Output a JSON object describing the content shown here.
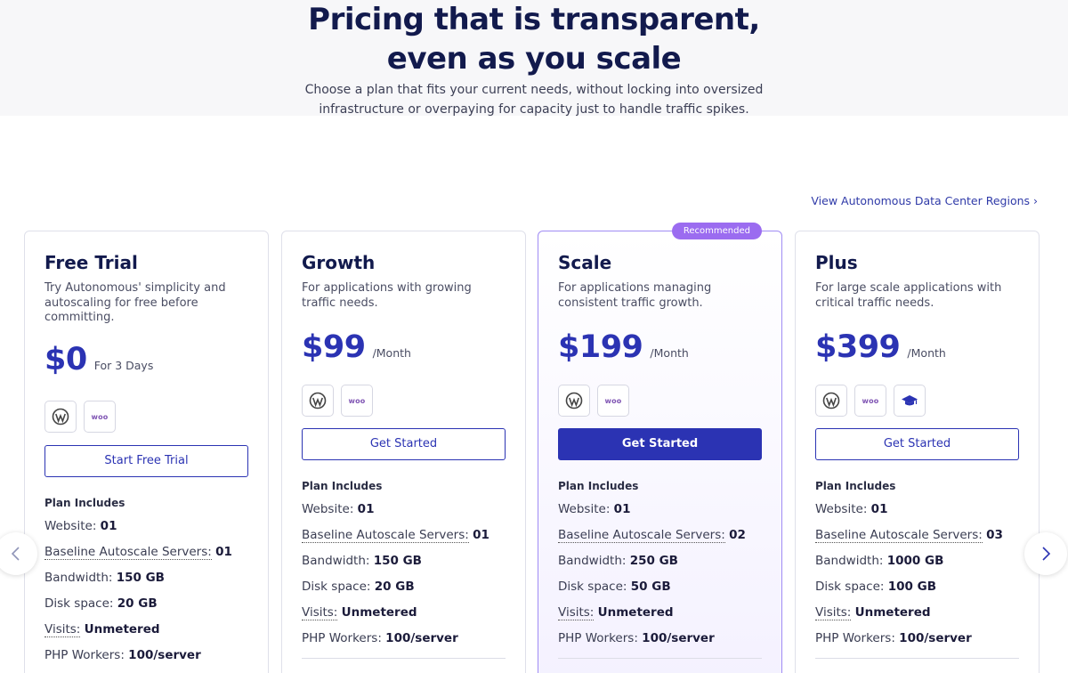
{
  "hero": {
    "title_line1": "Pricing that is transparent,",
    "title_line2": "even as you scale",
    "subtitle": "Choose a plan that fits your current needs, without locking into oversized infrastructure or overpaying for capacity just to handle traffic spikes."
  },
  "regions_link": "View Autonomous Data Center Regions ›",
  "plans": [
    {
      "name": "Free Trial",
      "description": "Try Autonomous' simplicity and autoscaling for free before committing.",
      "price": "$0",
      "period": "For 3 Days",
      "icons": [
        "wordpress-icon",
        "woo-icon"
      ],
      "cta": "Start Free Trial",
      "includes_label": "Plan Includes",
      "features": {
        "website_label": "Website:",
        "website_value": "01",
        "servers_label": "Baseline Autoscale Servers:",
        "servers_value": "01",
        "bandwidth_label": "Bandwidth:",
        "bandwidth_value": "150 GB",
        "disk_label": "Disk space:",
        "disk_value": "20 GB",
        "visits_label": "Visits:",
        "visits_value": "Unmetered",
        "php_label": "PHP Workers:",
        "php_value": "100/server"
      }
    },
    {
      "name": "Growth",
      "description": "For applications with growing traffic needs.",
      "price": "$99",
      "period": "/Month",
      "icons": [
        "wordpress-icon",
        "woo-icon"
      ],
      "cta": "Get Started",
      "includes_label": "Plan Includes",
      "features": {
        "website_label": "Website:",
        "website_value": "01",
        "servers_label": "Baseline Autoscale Servers:",
        "servers_value": "01",
        "bandwidth_label": "Bandwidth:",
        "bandwidth_value": "150 GB",
        "disk_label": "Disk space:",
        "disk_value": "20 GB",
        "visits_label": "Visits:",
        "visits_value": "Unmetered",
        "php_label": "PHP Workers:",
        "php_value": "100/server"
      }
    },
    {
      "name": "Scale",
      "badge": "Recommended",
      "description": "For applications managing consistent traffic growth.",
      "price": "$199",
      "period": "/Month",
      "icons": [
        "wordpress-icon",
        "woo-icon"
      ],
      "cta": "Get Started",
      "includes_label": "Plan Includes",
      "features": {
        "website_label": "Website:",
        "website_value": "01",
        "servers_label": "Baseline Autoscale Servers:",
        "servers_value": "02",
        "bandwidth_label": "Bandwidth:",
        "bandwidth_value": "250 GB",
        "disk_label": "Disk space:",
        "disk_value": "50 GB",
        "visits_label": "Visits:",
        "visits_value": "Unmetered",
        "php_label": "PHP Workers:",
        "php_value": "100/server"
      }
    },
    {
      "name": "Plus",
      "description": "For large scale applications with critical traffic needs.",
      "price": "$399",
      "period": "/Month",
      "icons": [
        "wordpress-icon",
        "woo-icon",
        "graduation-cap-icon"
      ],
      "cta": "Get Started",
      "includes_label": "Plan Includes",
      "features": {
        "website_label": "Website:",
        "website_value": "01",
        "servers_label": "Baseline Autoscale Servers:",
        "servers_value": "03",
        "bandwidth_label": "Bandwidth:",
        "bandwidth_value": "1000 GB",
        "disk_label": "Disk space:",
        "disk_value": "100 GB",
        "visits_label": "Visits:",
        "visits_value": "Unmetered",
        "php_label": "PHP Workers:",
        "php_value": "100/server"
      }
    }
  ],
  "woo_label": "woo",
  "colors": {
    "accent": "#2b33b3",
    "badge": "#9b6cf0",
    "title": "#121a4d",
    "woo": "#7f54b3"
  }
}
